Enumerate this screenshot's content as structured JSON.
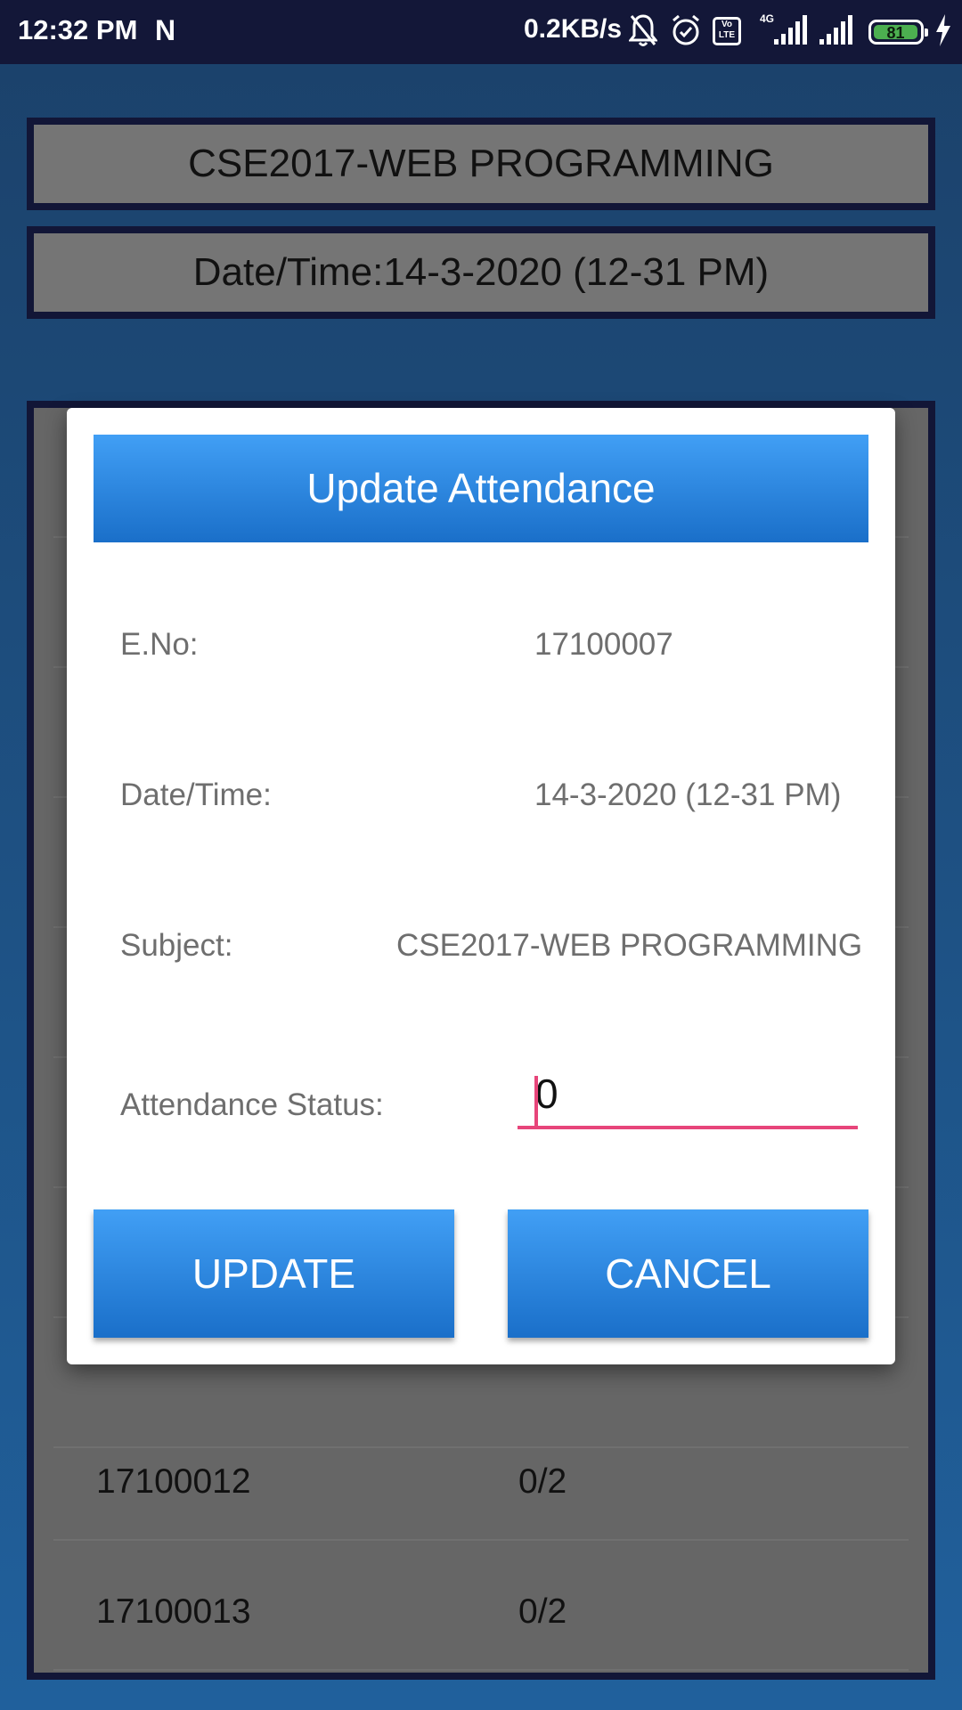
{
  "status_bar": {
    "time": "12:32 PM",
    "carrier_glyph": "N",
    "net_speed": "0.2KB/s",
    "volte_label": "Vo LTE",
    "network_type": "4G",
    "battery_level": "81",
    "icons": [
      "notifications-off-icon",
      "alarm-icon",
      "volte-icon",
      "signal-icon",
      "signal-icon",
      "battery-icon",
      "charging-icon"
    ]
  },
  "page": {
    "subject_header": "CSE2017-WEB PROGRAMMING",
    "datetime_header": "Date/Time:14-3-2020 (12-31 PM)",
    "rows": [
      {
        "eno": "17100012",
        "status": "0/2"
      },
      {
        "eno": "17100013",
        "status": "0/2"
      }
    ]
  },
  "dialog": {
    "title": "Update Attendance",
    "fields": {
      "eno_label": "E.No:",
      "eno_value": "17100007",
      "datetime_label": "Date/Time:",
      "datetime_value": "14-3-2020 (12-31 PM)",
      "subject_label": "Subject:",
      "subject_value": "CSE2017-WEB PROGRAMMING",
      "status_label": "Attendance Status:",
      "status_value": "0"
    },
    "update_label": "UPDATE",
    "cancel_label": "CANCEL"
  },
  "colors": {
    "status_bar_bg": "#131738",
    "background": "#1e5285",
    "panel": "#666666",
    "accent_blue": "#2b87e3",
    "input_underline": "#e7457a"
  }
}
